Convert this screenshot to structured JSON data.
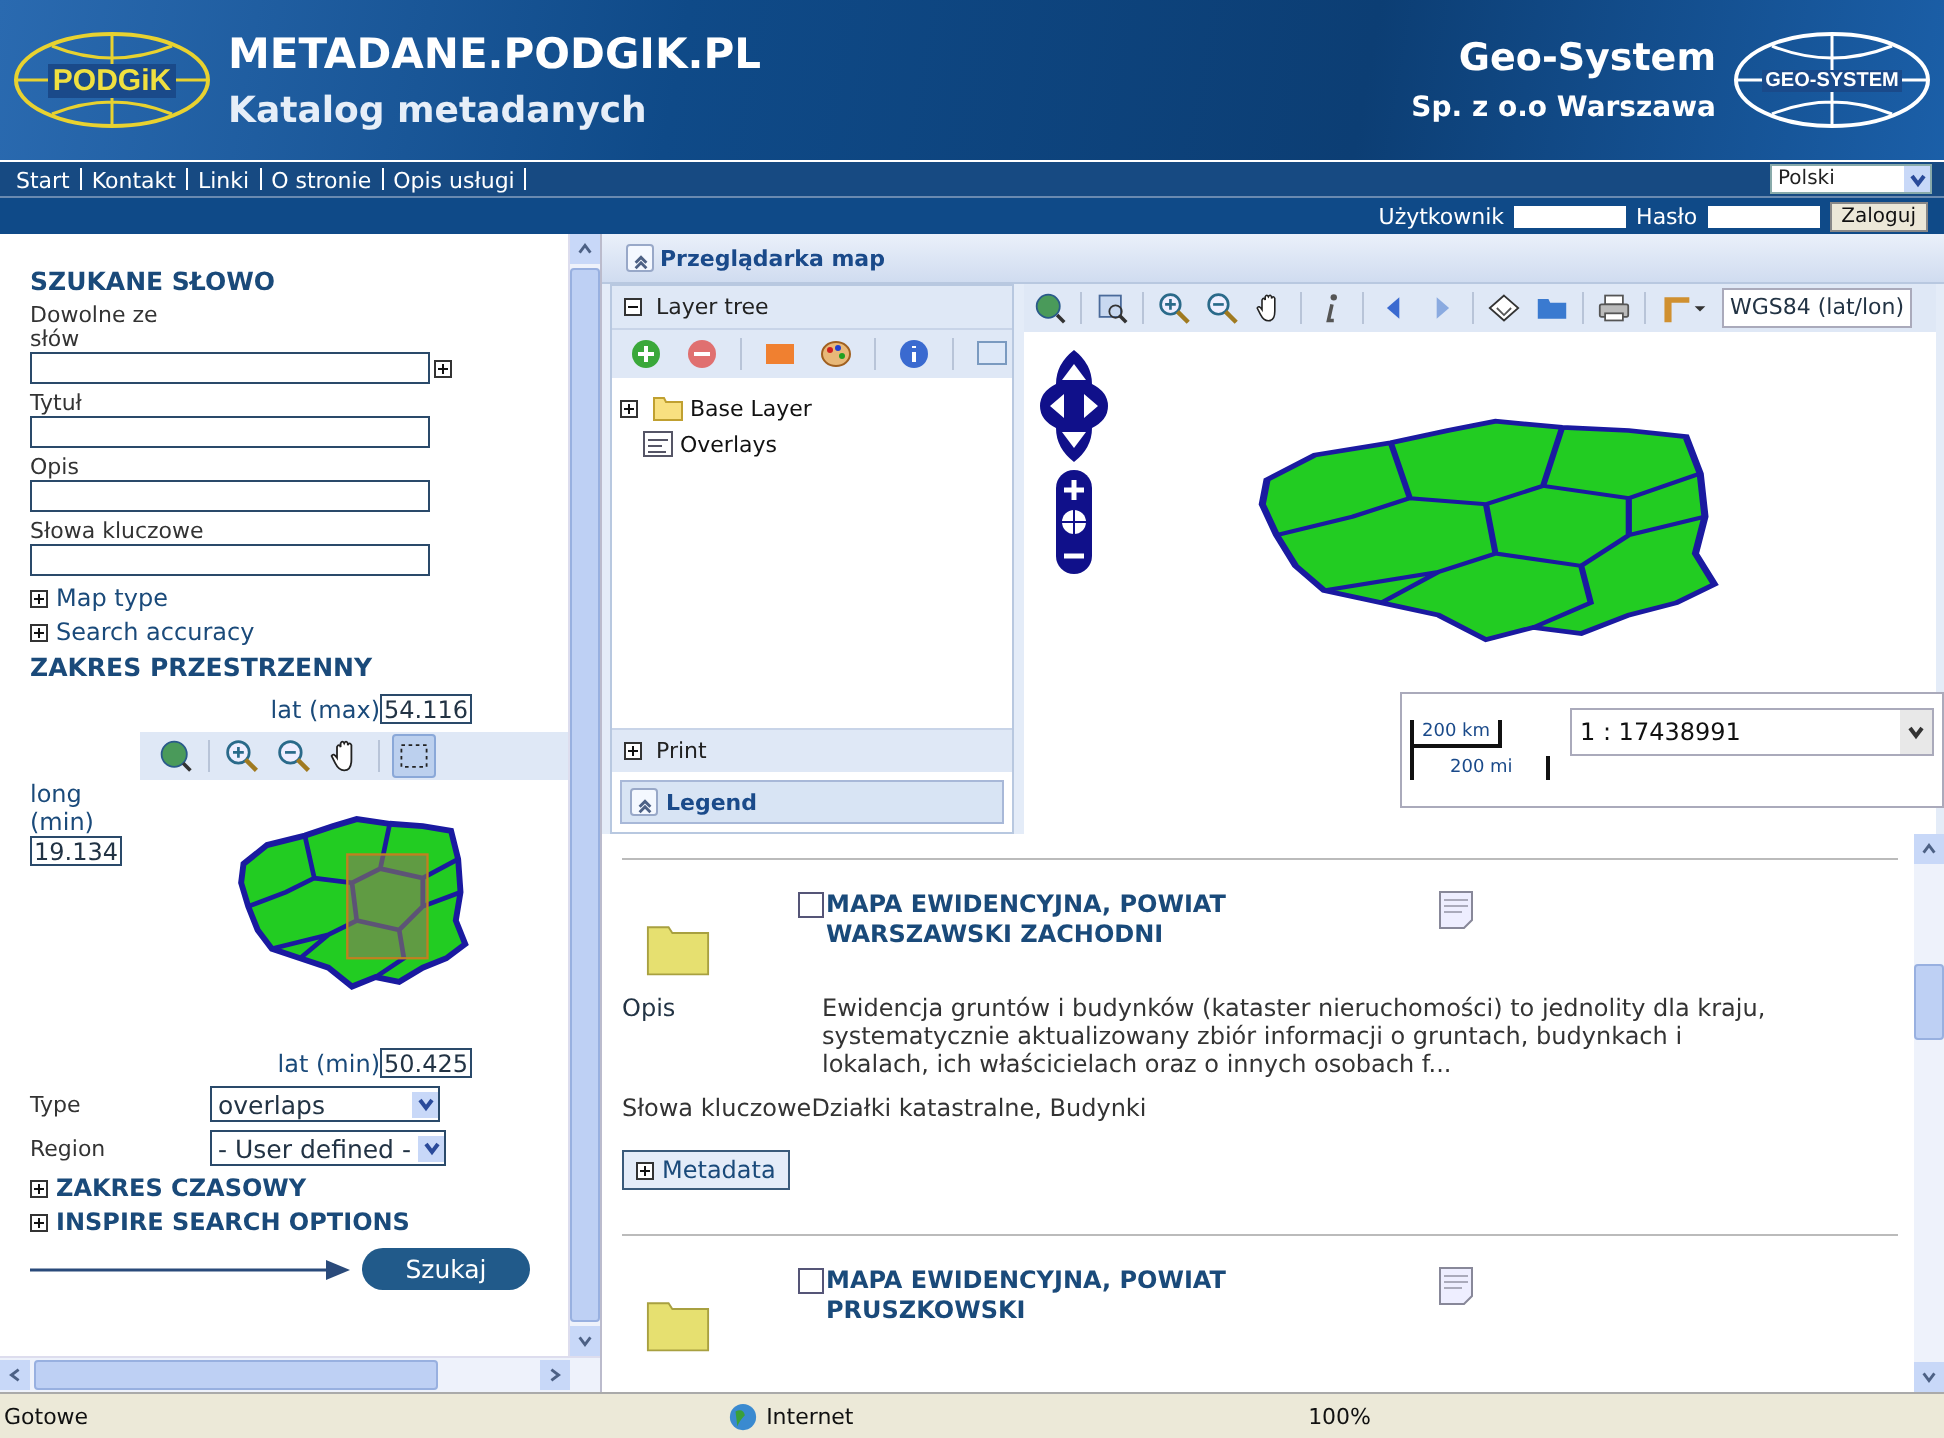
{
  "header": {
    "logo_left": "PODGiK",
    "title": "METADANE.PODGIK.PL",
    "subtitle": "Katalog metadanych",
    "company": "Geo-System",
    "company_sub": "Sp. z o.o Warszawa",
    "logo_right": "GEO-SYSTEM"
  },
  "nav": {
    "links": [
      "Start",
      "Kontakt",
      "Linki",
      "O stronie",
      "Opis usługi"
    ],
    "language": "Polski"
  },
  "login": {
    "user_label": "Użytkownik",
    "password_label": "Hasło",
    "button": "Zaloguj"
  },
  "search": {
    "heading": "SZUKANE SŁOWO",
    "fields": [
      {
        "label": "Dowolne ze słów",
        "kind": "expandable"
      },
      {
        "label": "Tytuł",
        "kind": "plain"
      },
      {
        "label": "Opis",
        "kind": "plain"
      },
      {
        "label": "Słowa kluczowe",
        "kind": "plain"
      }
    ],
    "toggles": [
      {
        "label": "Map type",
        "expanded": false
      },
      {
        "label": "Search accuracy",
        "expanded": false
      }
    ]
  },
  "spatial": {
    "heading": "ZAKRES PRZESTRZENNY",
    "lat_max_label": "lat (max)",
    "lat_max": "54.116",
    "long_min_label": "long (min)",
    "long_min": "19.134",
    "lat_min_label": "lat (min)",
    "lat_min": "50.425",
    "tools": [
      {
        "kind": "extent",
        "selected": false
      },
      {
        "kind": "zoom-in",
        "selected": false
      },
      {
        "kind": "zoom-out",
        "selected": false
      },
      {
        "kind": "pan",
        "selected": false
      },
      {
        "kind": "box",
        "selected": true
      }
    ]
  },
  "filters": [
    {
      "label": "Type",
      "value": "overlaps"
    },
    {
      "label": "Region",
      "value": "- User defined -"
    }
  ],
  "sections": [
    {
      "label": "ZAKRES CZASOWY",
      "expanded": false
    },
    {
      "label": "INSPIRE SEARCH OPTIONS",
      "expanded": false
    }
  ],
  "search_button": "Szukaj",
  "viewer": {
    "title": "Przeglądarka map",
    "layer_tree": {
      "title": "Layer tree",
      "expanded": true,
      "layers": [
        {
          "name": "Base Layer",
          "kind": "folder",
          "expanded": false
        },
        {
          "name": "Overlays",
          "kind": "overlay"
        }
      ]
    },
    "print": {
      "label": "Print",
      "expanded": false
    },
    "legend": "Legend",
    "projection": "WGS84 (lat/lon)",
    "scale": "1 : 17438991",
    "scale_km": "200 km",
    "scale_mi": "200 mi"
  },
  "results": {
    "items": [
      {
        "title": "MAPA EWIDENCYJNA, POWIAT WARSZAWSKI ZACHODNI",
        "checked": false,
        "description_label": "Opis",
        "description": "Ewidencja gruntów i budynków (kataster nieruchomości) to jednolity dla kraju, systematycznie aktualizowany zbiór informacji o gruntach, budynkach i lokalach, ich właścicielach oraz o innych osobach f...",
        "keywords_label": "Słowa kluczowe",
        "keywords": "Działki katastralne, Budynki",
        "metadata_button": "Metadata"
      },
      {
        "title": "MAPA EWIDENCYJNA, POWIAT PRUSZKOWSKI",
        "checked": false
      }
    ]
  },
  "status_bar": {
    "text": "Gotowe",
    "zone": "Internet",
    "zoom": "100%"
  }
}
